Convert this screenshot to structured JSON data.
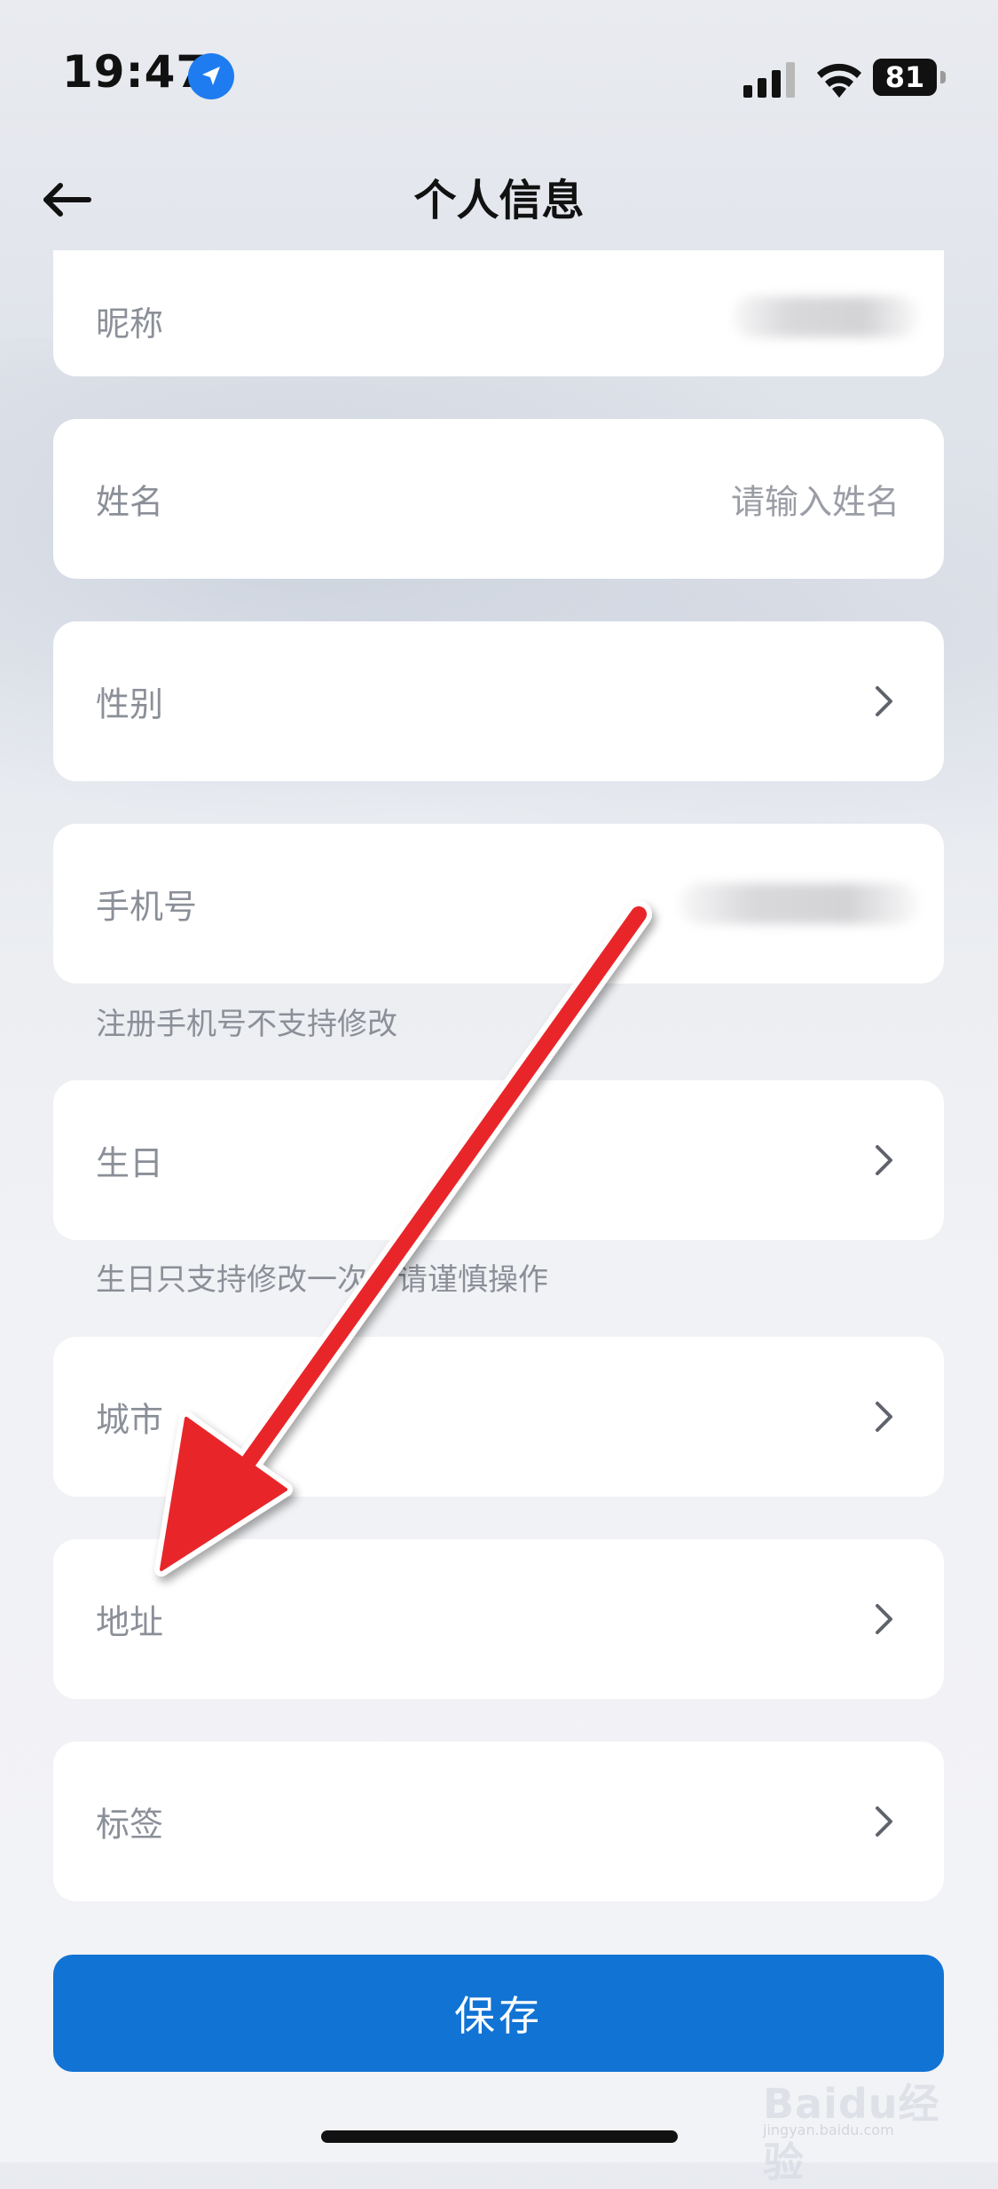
{
  "status_bar": {
    "time": "19:47",
    "battery": "81",
    "icons": [
      "location-arrow-icon",
      "cellular-signal-icon",
      "wifi-icon",
      "battery-icon"
    ]
  },
  "nav": {
    "title": "个人信息",
    "back_icon": "back-arrow-icon"
  },
  "fields": {
    "nickname": {
      "label": "昵称"
    },
    "name": {
      "label": "姓名",
      "placeholder": "请输入姓名"
    },
    "gender": {
      "label": "性别"
    },
    "phone": {
      "label": "手机号",
      "hint": "注册手机号不支持修改"
    },
    "birthday": {
      "label": "生日",
      "hint": "生日只支持修改一次，请谨慎操作"
    },
    "city": {
      "label": "城市"
    },
    "address": {
      "label": "地址"
    },
    "tags": {
      "label": "标签"
    }
  },
  "save_label": "保存",
  "colors": {
    "primary": "#1173d4",
    "annotation_arrow": "#e8262a",
    "label_gray": "#8b8f98"
  },
  "watermark": {
    "brand": "Baidu经验",
    "url": "jingyan.baidu.com"
  }
}
